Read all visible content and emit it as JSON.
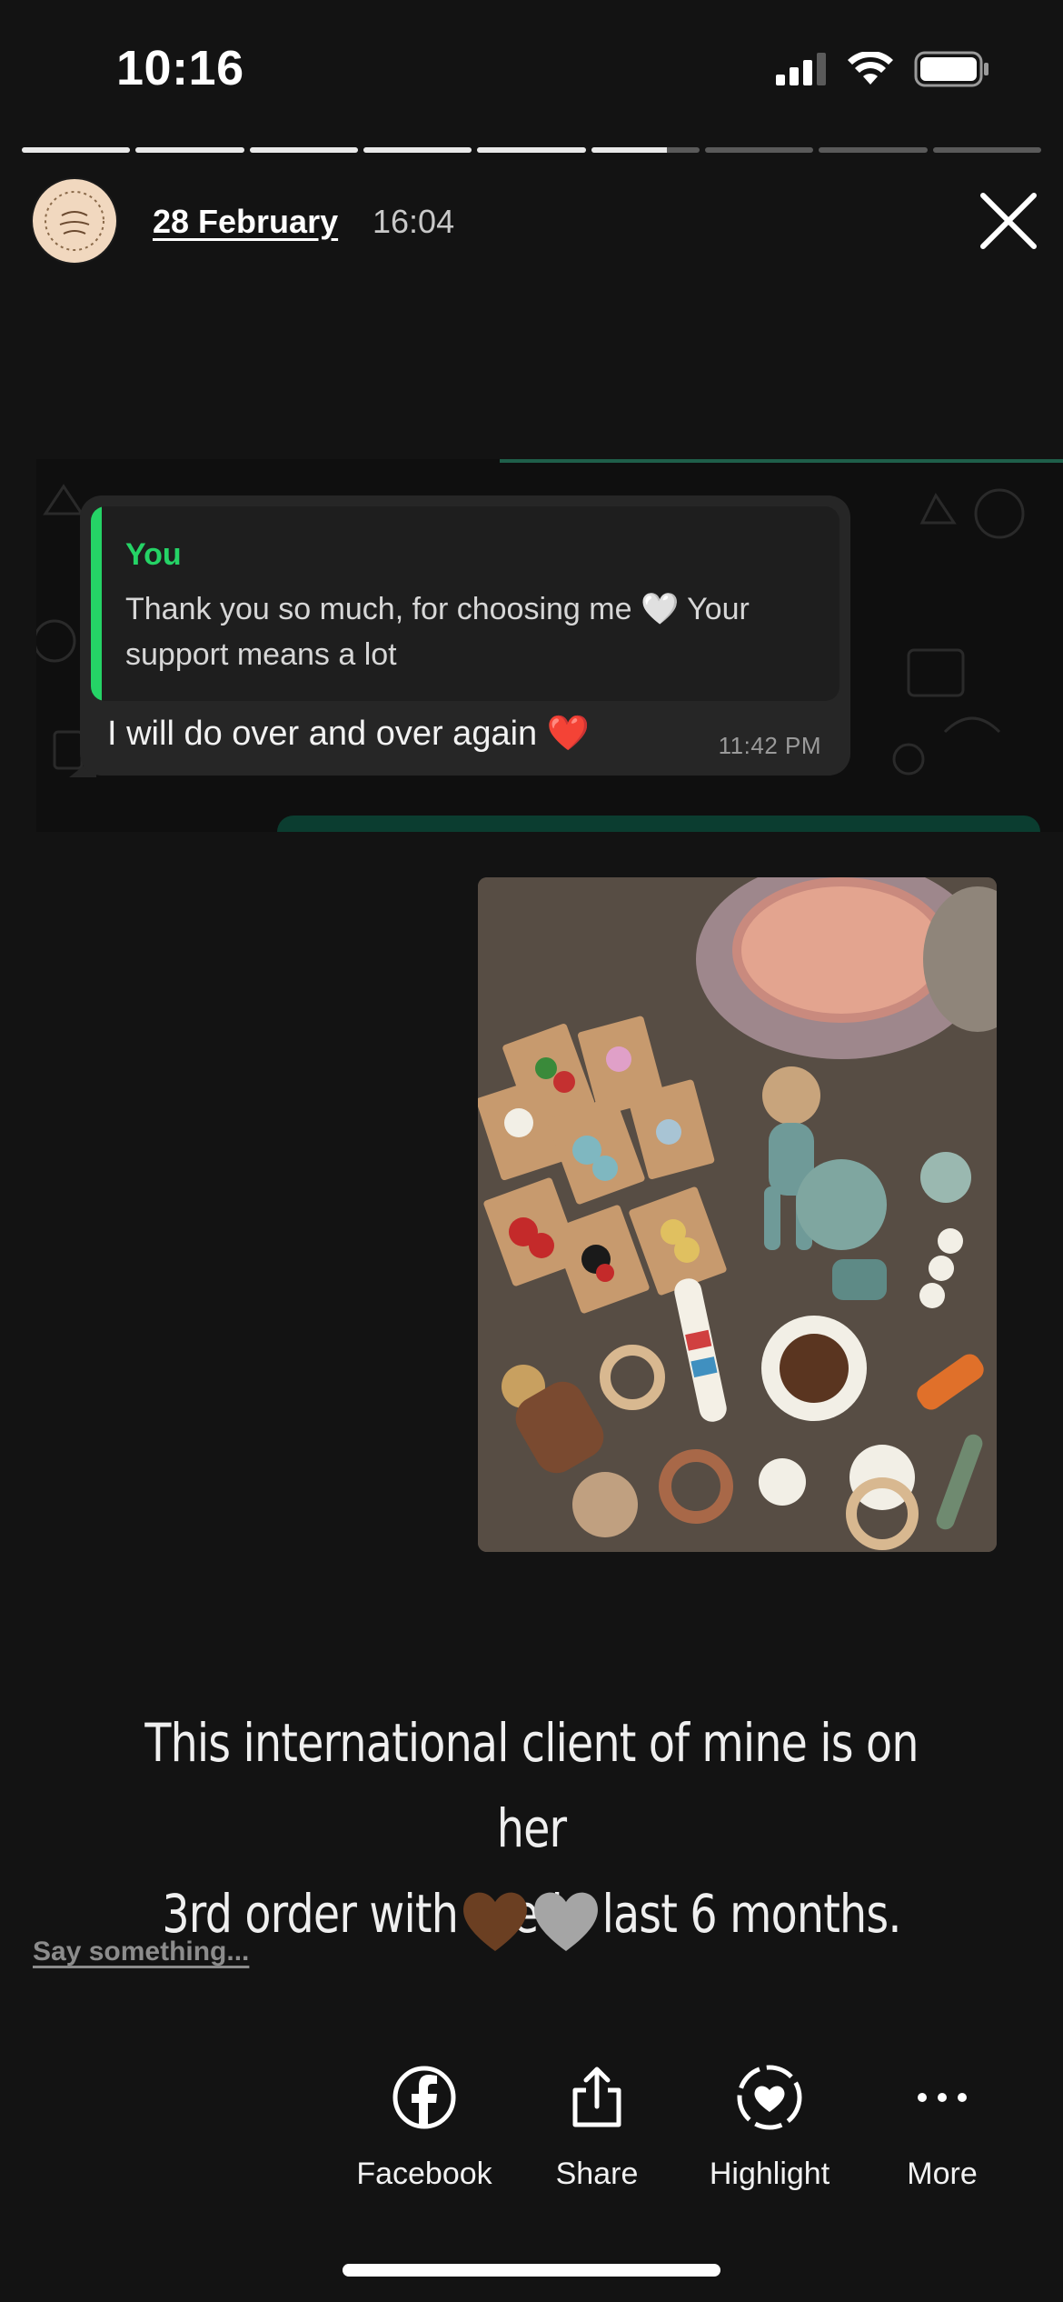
{
  "status_bar": {
    "time": "10:16"
  },
  "story": {
    "progress": {
      "segments": 9,
      "completed": 5,
      "current_fraction": 0.7
    },
    "header": {
      "date": "28 February",
      "time": "16:04"
    }
  },
  "chat": {
    "quote_author": "You",
    "quote_text": "Thank you so much, for choosing me 🤍 Your support means a lot",
    "message": "I will do over and over again ❤️",
    "message_time": "11:42 PM"
  },
  "caption": {
    "line1": "This international client of mine is on her",
    "line2": "3rd order with me in last 6 months."
  },
  "reply": {
    "placeholder": "Say something..."
  },
  "actions": [
    {
      "label": "Facebook",
      "icon": "facebook-icon"
    },
    {
      "label": "Share",
      "icon": "share-icon"
    },
    {
      "label": "Highlight",
      "icon": "highlight-heart-icon"
    },
    {
      "label": "More",
      "icon": "more-dots-icon"
    }
  ],
  "colors": {
    "accent_green": "#25d366",
    "background": "#131313"
  }
}
